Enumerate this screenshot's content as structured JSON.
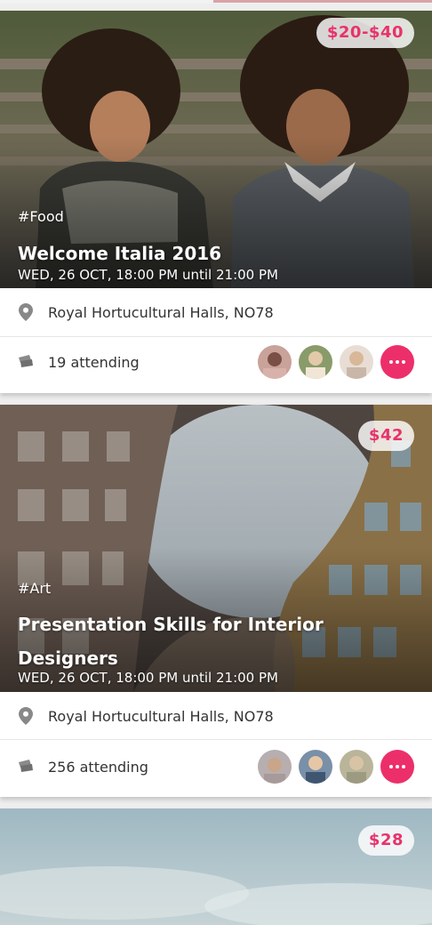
{
  "events": [
    {
      "price": "$20-$40",
      "tag": "#Food",
      "title": "Welcome Italia 2016",
      "datetime": "WED, 26 OCT, 18:00 PM until 21:00 PM",
      "location": "Royal Hortucultural Halls, NO78",
      "attending": "19 attending"
    },
    {
      "price": "$42",
      "tag": "#Art",
      "title": "Presentation Skills for Interior Designers",
      "datetime": "WED, 26 OCT, 18:00 PM until 21:00 PM",
      "location": "Royal Hortucultural Halls, NO78",
      "attending": "256 attending"
    },
    {
      "price": "$28"
    }
  ],
  "icons": {
    "location": "location-pin-icon",
    "tickets": "tickets-icon",
    "more": "more-horizontal-icon"
  },
  "colors": {
    "accent": "#ec2f6a",
    "price_text": "#e8326b"
  }
}
